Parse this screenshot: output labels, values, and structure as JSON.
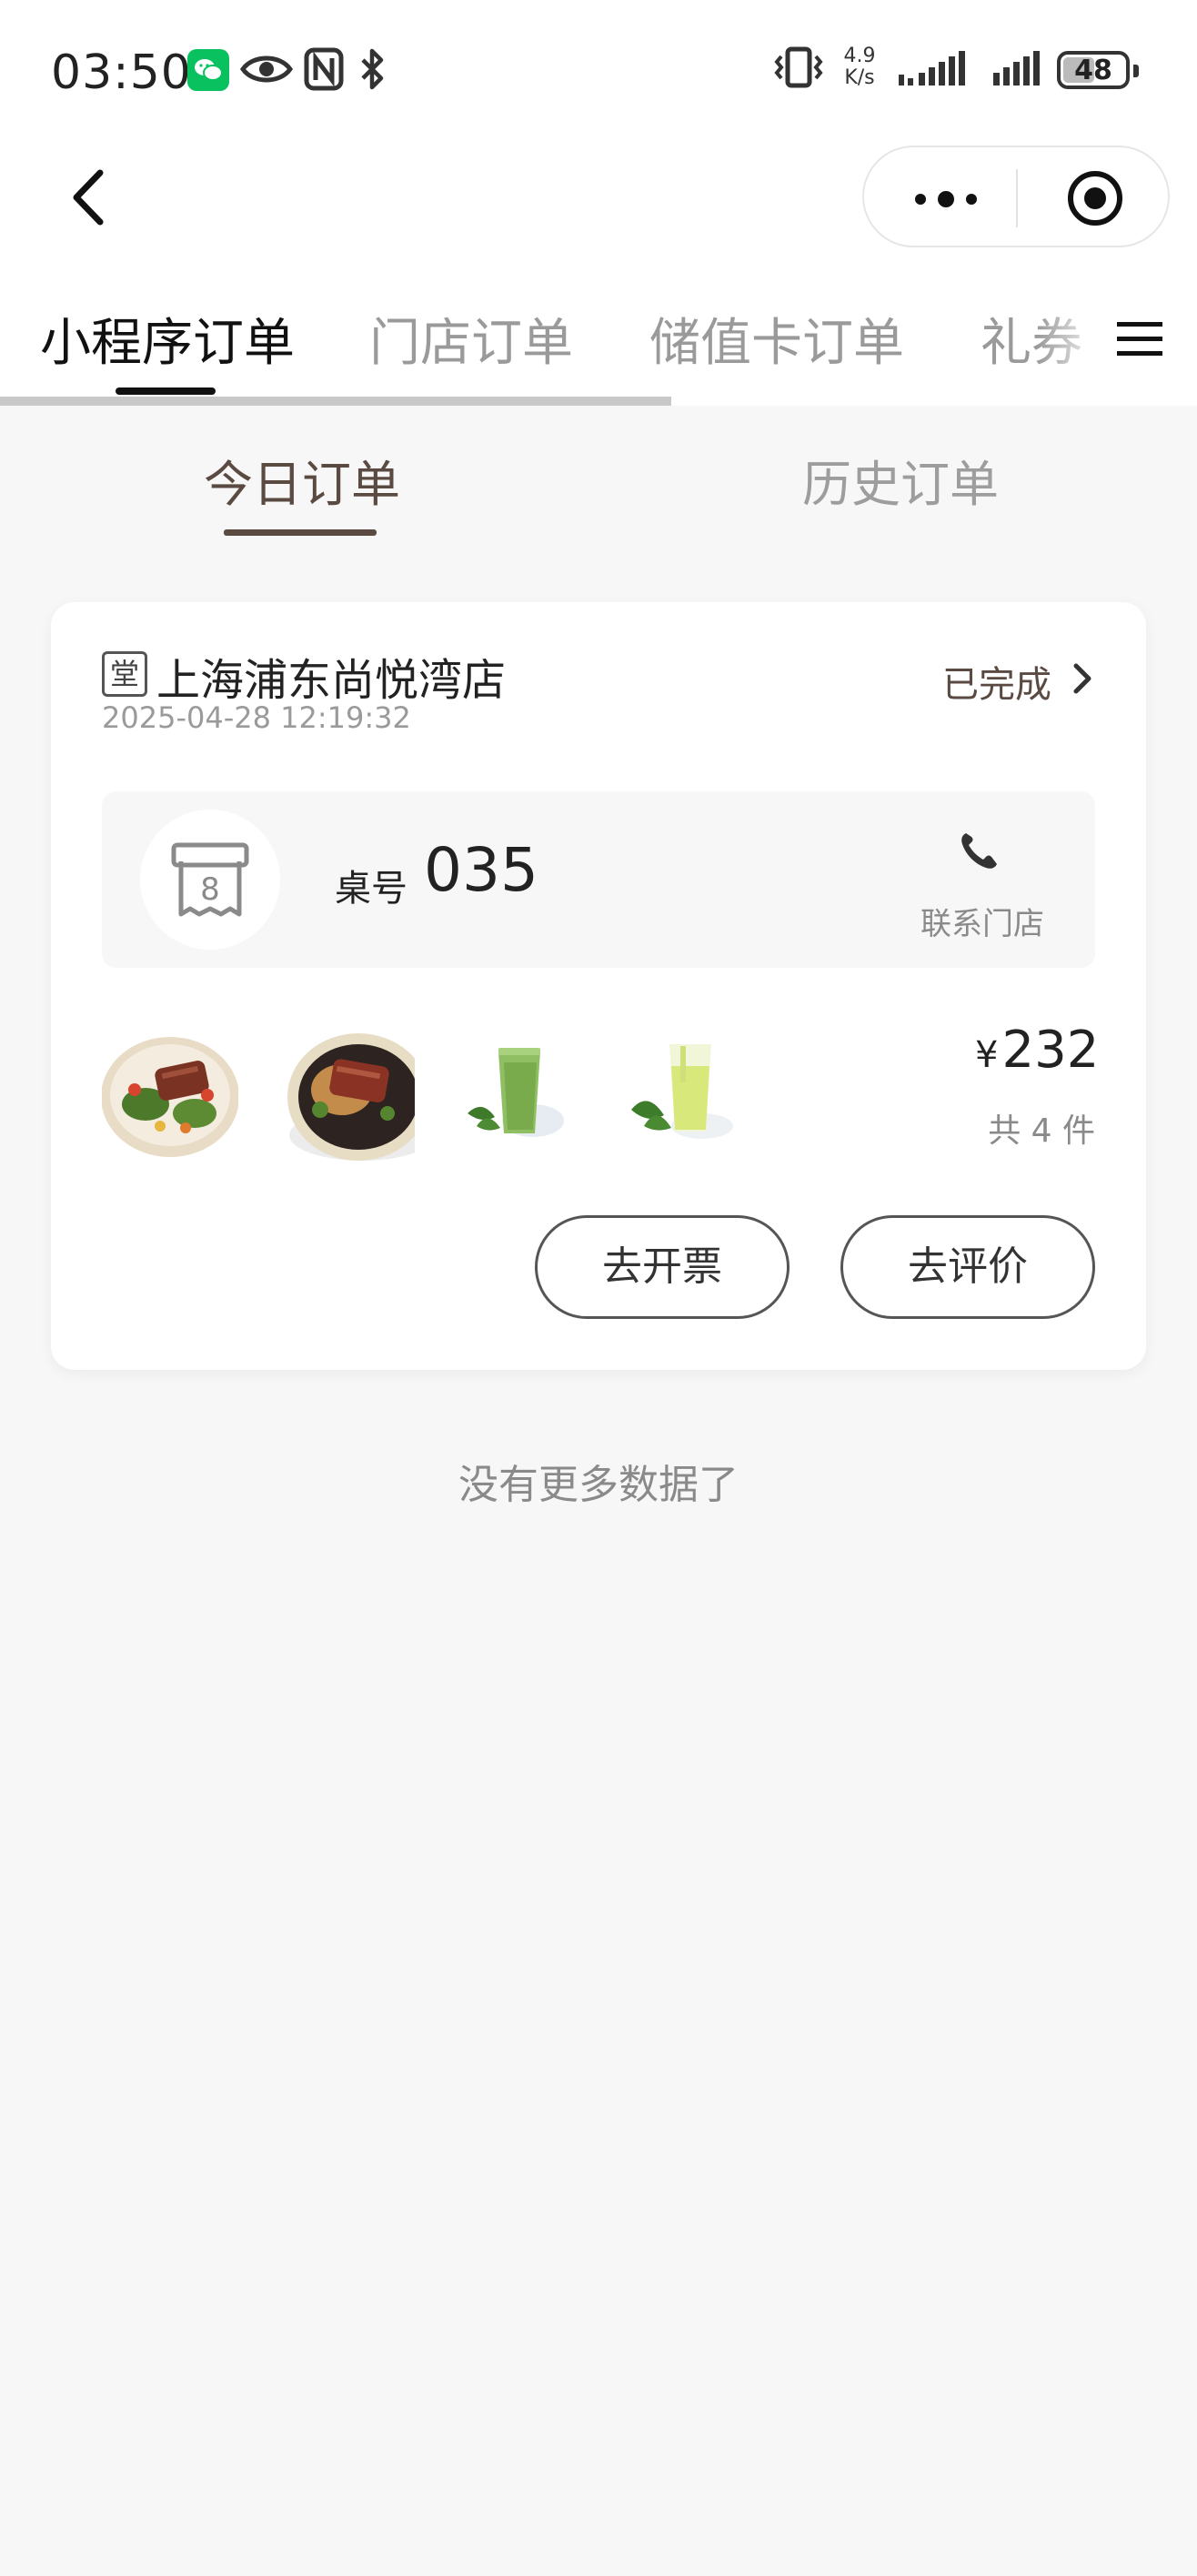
{
  "status_bar": {
    "time": "03:50",
    "network_speed_value": "4.9",
    "network_speed_unit": "K/s",
    "battery": "48",
    "icons": [
      "wechat-icon",
      "eye-icon",
      "nfc-icon",
      "bluetooth-icon",
      "vibrate-icon",
      "signal-icon",
      "signal-icon",
      "battery-icon"
    ]
  },
  "nav": {
    "back_icon": "chevron-left-icon",
    "capsule_icons": [
      "more-dots-icon",
      "target-icon"
    ]
  },
  "tabs": {
    "items": [
      "小程序订单",
      "门店订单",
      "储值卡订单",
      "礼券"
    ],
    "active_index": 0,
    "menu_icon": "menu-icon"
  },
  "subtabs": {
    "items": [
      "今日订单",
      "历史订单"
    ],
    "active_index": 0
  },
  "order": {
    "store_tag": "堂",
    "store_name": "上海浦东尚悦湾店",
    "datetime": "2025-04-28 12:19:32",
    "status": "已完成",
    "table_label": "桌号",
    "table_number": "035",
    "table_icon_number": "8",
    "contact_label": "联系门店",
    "currency_symbol": "¥",
    "price": "232",
    "item_count": "共 4 件",
    "items": [
      "beef-salad",
      "beef-grain-bowl",
      "green-juice",
      "lime-drink"
    ],
    "buttons": {
      "invoice": "去开票",
      "review": "去评价"
    }
  },
  "footer": {
    "no_more": "没有更多数据了"
  },
  "colors": {
    "accent": "#5a4a42",
    "background": "#f7f7f7",
    "wechat_green": "#09c15f"
  }
}
